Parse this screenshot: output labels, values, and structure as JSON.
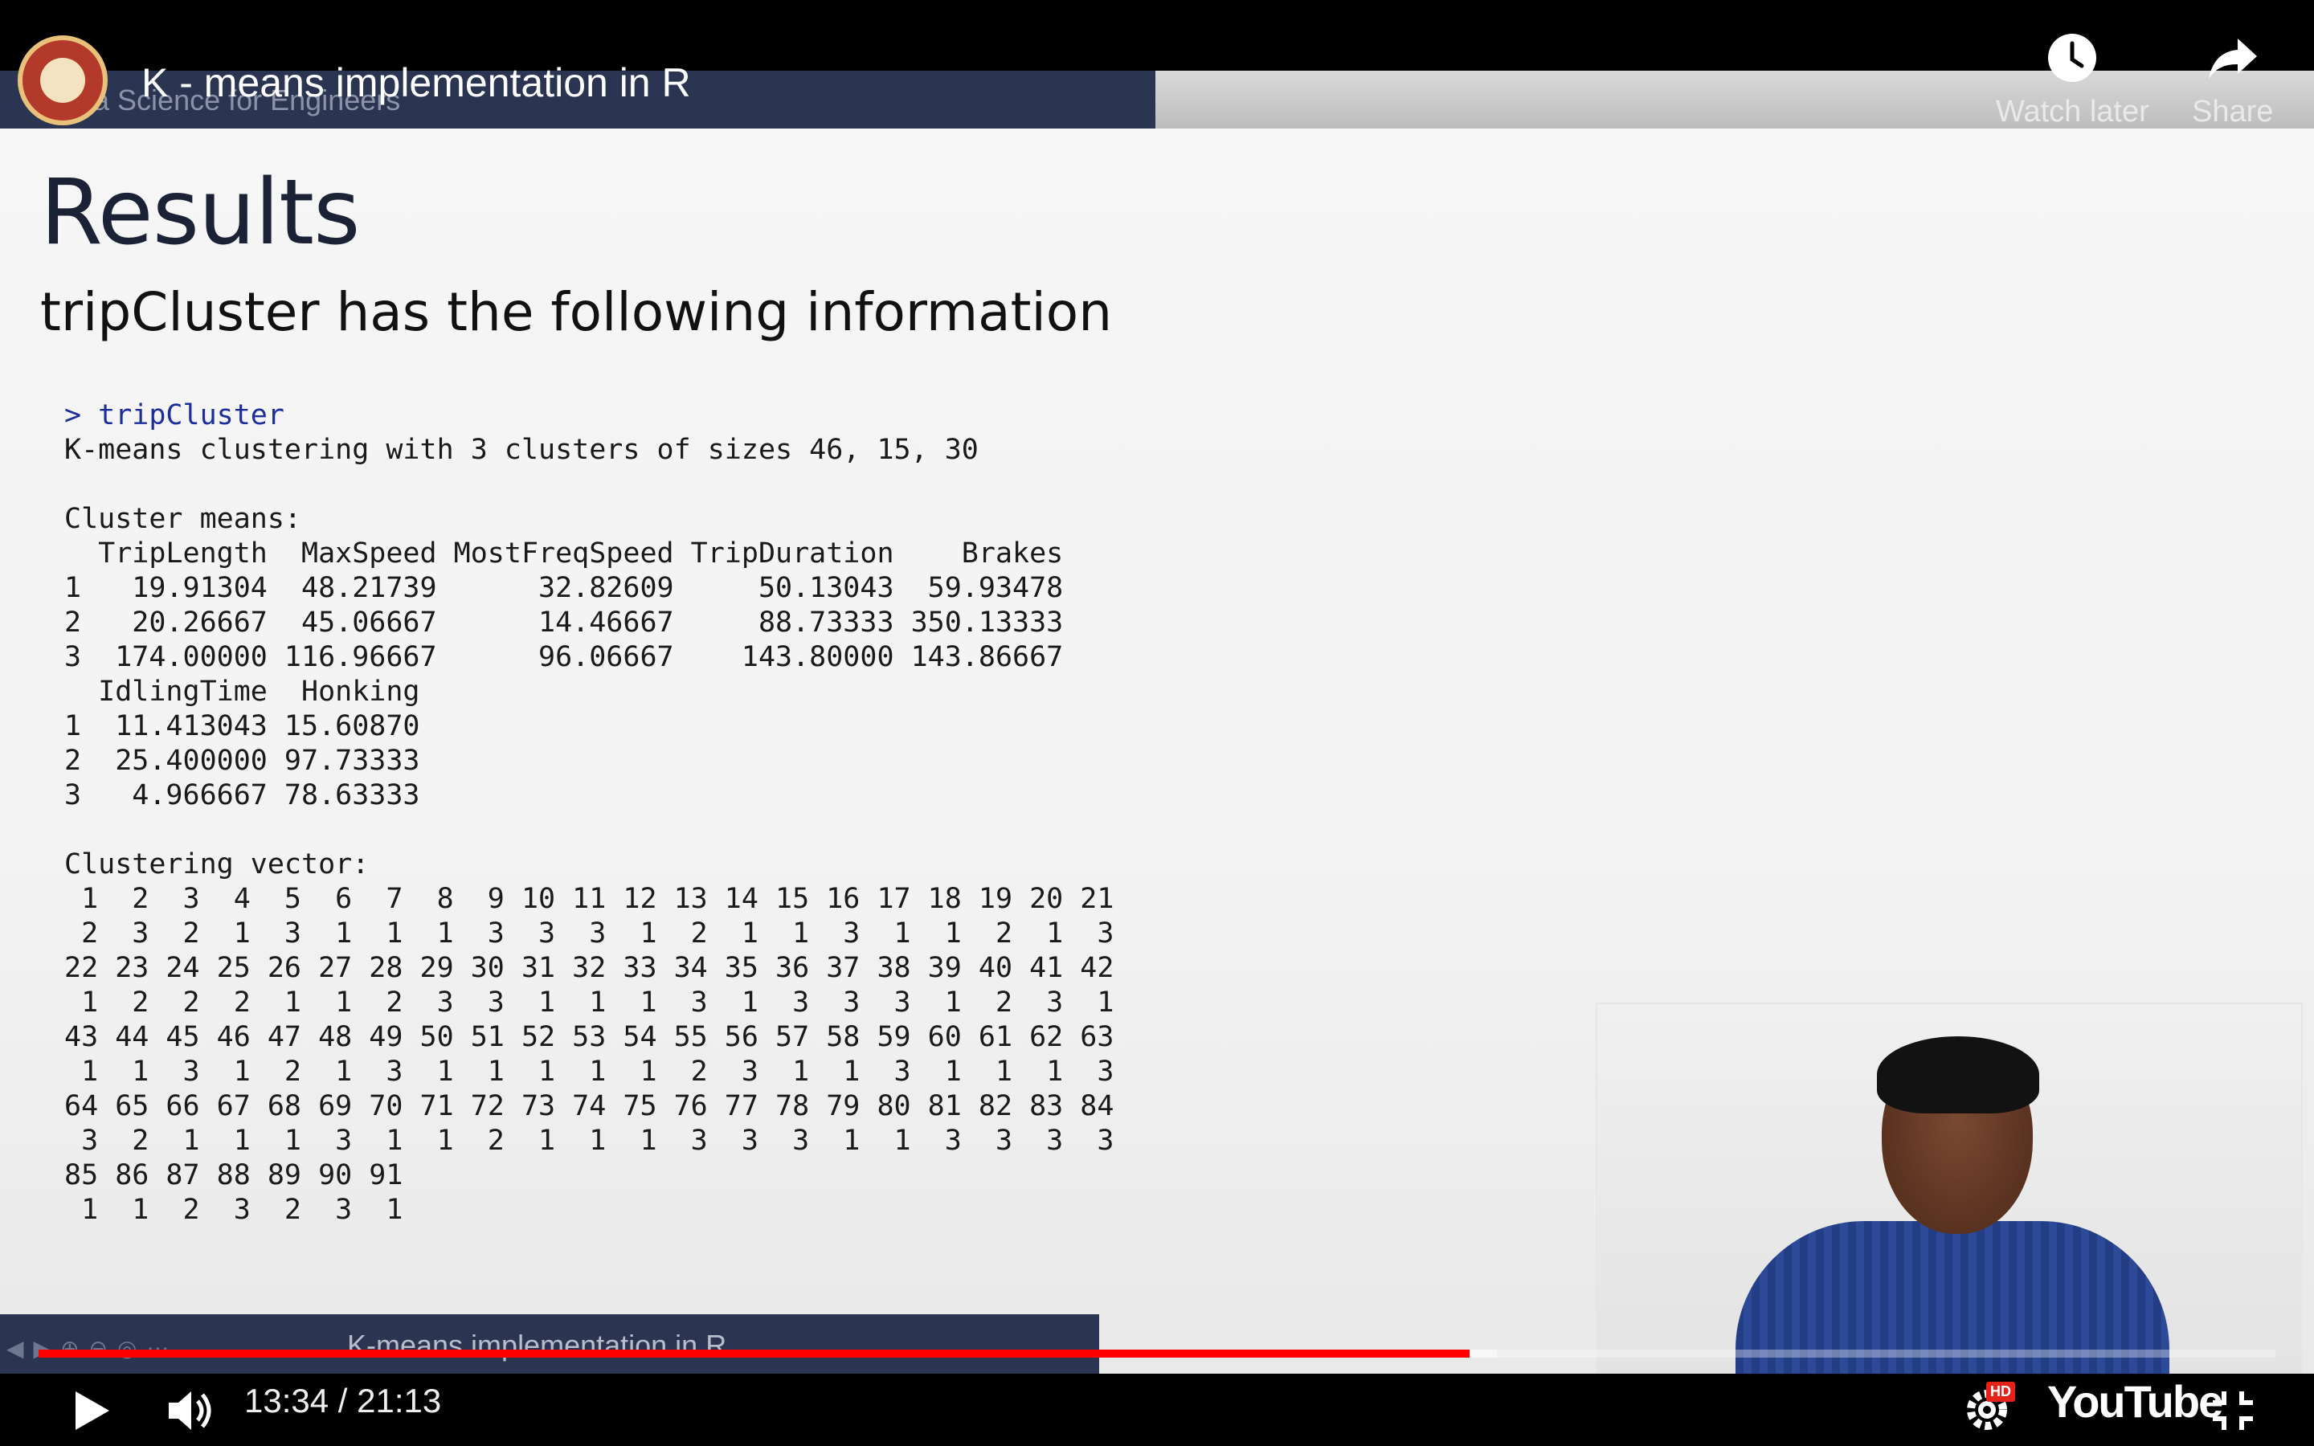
{
  "player": {
    "video_title": "K - means implementation in R",
    "watch_later_label": "Watch later",
    "share_label": "Share",
    "current_time": "13:34",
    "duration": "21:13",
    "time_display": "13:34 / 21:13",
    "progress_fraction": 0.6398,
    "buffered_fraction": 0.652,
    "brand_label": "YouTube",
    "hd_badge": "HD",
    "colors": {
      "progress": "#ff0000",
      "chrome_bg": "#000000"
    }
  },
  "slide": {
    "header_text": "Data Science for Engineers",
    "title": "Results",
    "subtitle": "tripCluster has the following information",
    "footer_text": "K-means implementation in R",
    "console": [
      {
        "text": "> tripCluster",
        "cmd": true
      },
      {
        "text": "K-means clustering with 3 clusters of sizes 46, 15, 30"
      },
      {
        "text": ""
      },
      {
        "text": "Cluster means:"
      },
      {
        "text": "  TripLength  MaxSpeed MostFreqSpeed TripDuration    Brakes"
      },
      {
        "text": "1   19.91304  48.21739      32.82609     50.13043  59.93478"
      },
      {
        "text": "2   20.26667  45.06667      14.46667     88.73333 350.13333"
      },
      {
        "text": "3  174.00000 116.96667      96.06667    143.80000 143.86667"
      },
      {
        "text": "  IdlingTime  Honking"
      },
      {
        "text": "1  11.413043 15.60870"
      },
      {
        "text": "2  25.400000 97.73333"
      },
      {
        "text": "3   4.966667 78.63333"
      },
      {
        "text": ""
      },
      {
        "text": "Clustering vector:"
      },
      {
        "text": " 1  2  3  4  5  6  7  8  9 10 11 12 13 14 15 16 17 18 19 20 21"
      },
      {
        "text": " 2  3  2  1  3  1  1  1  3  3  3  1  2  1  1  3  1  1  2  1  3"
      },
      {
        "text": "22 23 24 25 26 27 28 29 30 31 32 33 34 35 36 37 38 39 40 41 42"
      },
      {
        "text": " 1  2  2  2  1  1  2  3  3  1  1  1  3  1  3  3  3  1  2  3  1"
      },
      {
        "text": "43 44 45 46 47 48 49 50 51 52 53 54 55 56 57 58 59 60 61 62 63"
      },
      {
        "text": " 1  1  3  1  2  1  3  1  1  1  1  1  2  3  1  1  3  1  1  1  3"
      },
      {
        "text": "64 65 66 67 68 69 70 71 72 73 74 75 76 77 78 79 80 81 82 83 84"
      },
      {
        "text": " 3  2  1  1  1  3  1  1  2  1  1  1  3  3  3  1  1  3  3  3  3"
      },
      {
        "text": "85 86 87 88 89 90 91"
      },
      {
        "text": " 1  1  2  3  2  3  1"
      }
    ]
  }
}
